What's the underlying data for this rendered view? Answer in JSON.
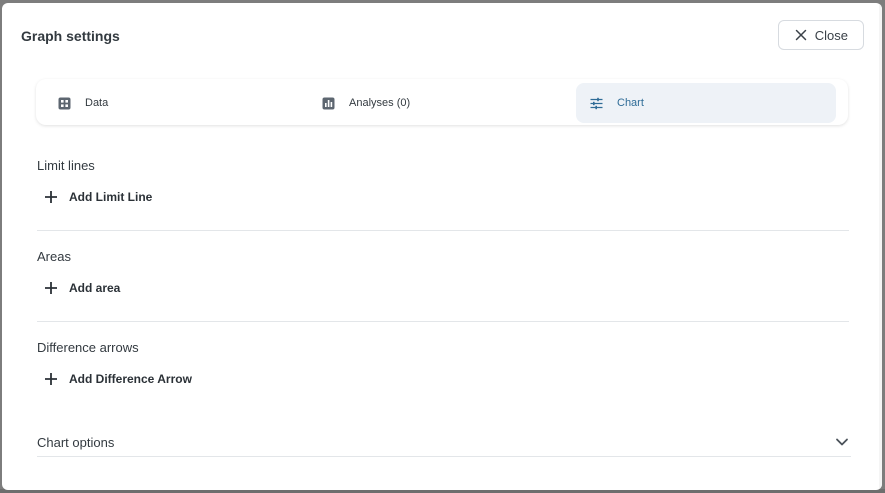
{
  "dialog": {
    "title": "Graph settings",
    "close_label": "Close"
  },
  "tabs": [
    {
      "label": "Data",
      "icon": "grid-icon"
    },
    {
      "label": "Analyses (0)",
      "icon": "bar-chart-icon"
    },
    {
      "label": "Chart",
      "icon": "sliders-icon",
      "active": true
    }
  ],
  "sections": {
    "limit_lines": {
      "title": "Limit lines",
      "action": "Add Limit Line"
    },
    "areas": {
      "title": "Areas",
      "action": "Add area"
    },
    "difference_arrows": {
      "title": "Difference arrows",
      "action": "Add Difference Arrow"
    }
  },
  "chart_options": {
    "title": "Chart options",
    "icon": "chevron-down-icon"
  },
  "colors": {
    "active_tab_bg": "#eef2f7",
    "active_tab_text": "#2f6c97",
    "text": "#333a40",
    "divider": "#e3e6e9"
  }
}
